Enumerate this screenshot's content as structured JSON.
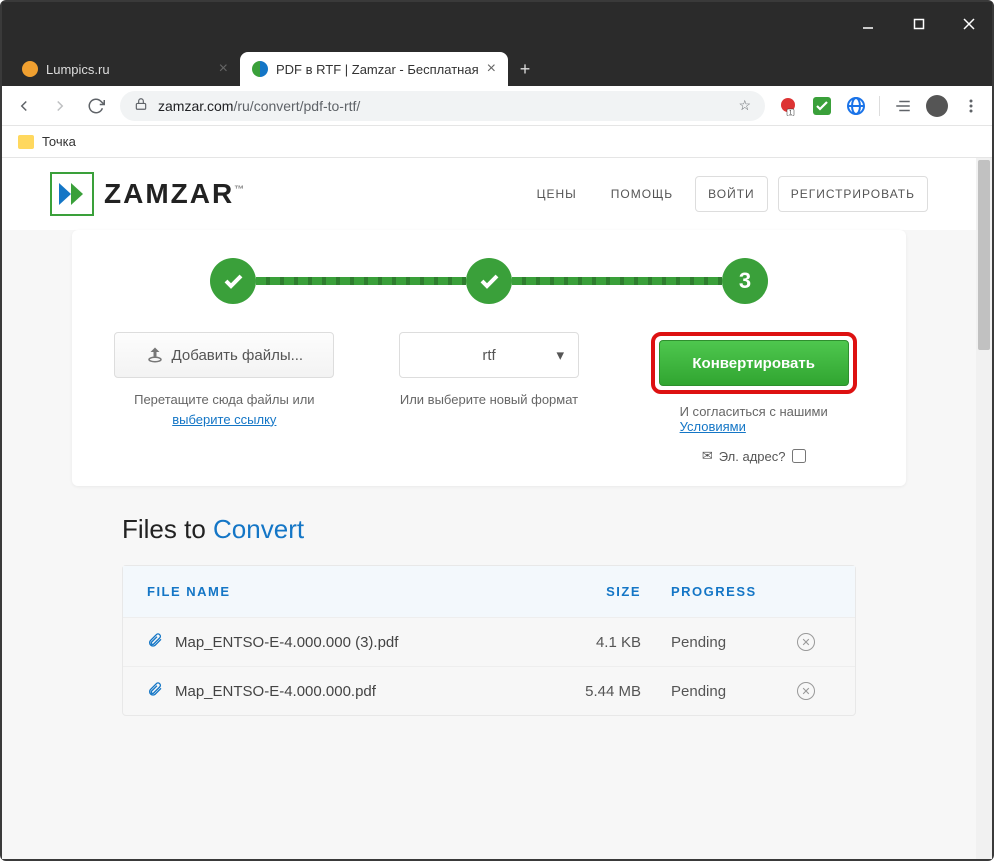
{
  "window": {
    "tabs": [
      {
        "title": "Lumpics.ru",
        "favicon": "#f0a030"
      },
      {
        "title": "PDF в RTF | Zamzar - Бесплатная",
        "favicon": "#3aa03a"
      }
    ],
    "url_domain": "zamzar.com",
    "url_path": "/ru/convert/pdf-to-rtf/"
  },
  "bookmarks": {
    "item1": "Точка"
  },
  "header": {
    "brand": "ZAMZAR",
    "tm": "™",
    "nav": {
      "pricing": "ЦЕНЫ",
      "help": "ПОМОЩЬ",
      "login": "ВОЙТИ",
      "signup": "РЕГИСТРИРОВАТЬ"
    }
  },
  "stepper": {
    "current": "3"
  },
  "add": {
    "button": "Добавить файлы...",
    "hint_prefix": "Перетащите сюда файлы или",
    "hint_link": "выберите ссылку"
  },
  "format": {
    "value": "rtf",
    "hint": "Или выберите новый формат"
  },
  "convert": {
    "button": "Конвертировать",
    "agree_prefix": "И согласиться с нашими",
    "agree_link": "Условиями",
    "email_label": "Эл. адрес?"
  },
  "files": {
    "title_a": "Files to ",
    "title_b": "Convert",
    "headers": {
      "name": "FILE NAME",
      "size": "SIZE",
      "progress": "PROGRESS"
    },
    "rows": [
      {
        "name": "Map_ENTSO-E-4.000.000 (3).pdf",
        "size": "4.1 KB",
        "progress": "Pending"
      },
      {
        "name": "Map_ENTSO-E-4.000.000.pdf",
        "size": "5.44 MB",
        "progress": "Pending"
      }
    ]
  }
}
